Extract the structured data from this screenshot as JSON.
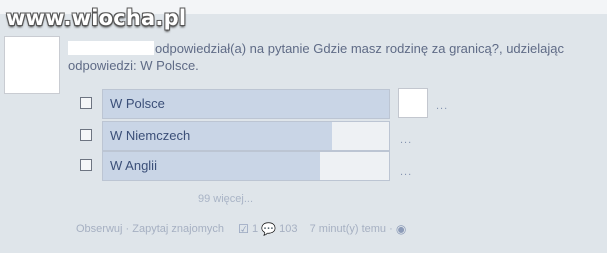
{
  "watermark": "www.wiocha.pl",
  "story": {
    "text_line1": "odpowiedział(a) na pytanie Gdzie masz rodzinę za granicą?, udzielając",
    "text_line2": "odpowiedzi: W Polsce."
  },
  "poll": {
    "options": [
      {
        "label": "W Polsce",
        "fill": 1.0,
        "dots": "..."
      },
      {
        "label": "W Niemczech",
        "fill": 0.8,
        "dots": "..."
      },
      {
        "label": "W Anglii",
        "fill": 0.76,
        "dots": "..."
      }
    ],
    "more_label": "99 więcej..."
  },
  "footer": {
    "follow_label": "Obserwuj",
    "separator": "·",
    "ask_friends_label": "Zapytaj znajomych",
    "checks_count": "1",
    "comments_count": "103",
    "time_label": "7 minut(y) temu",
    "checkbox_icon_glyph": "☑",
    "comment_icon_glyph": "💬",
    "globe_icon_glyph": "◉"
  },
  "colors": {
    "background": "#dfe5ea",
    "bar_fill": "#c9d5e6",
    "link_text": "#5f6b86"
  }
}
